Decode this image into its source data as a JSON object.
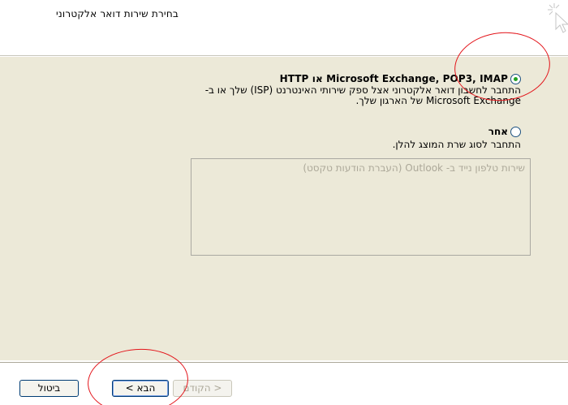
{
  "header": {
    "title": "בחירת שירות דואר אלקטרוני"
  },
  "options": {
    "option1": {
      "label": "Microsoft Exchange, POP3, IMAP או HTTP",
      "selected": true,
      "desc_line1": "התחבר לחשבון דואר אלקטרוני אצל ספק שירותי האינטרנט (ISP) שלך או ב-",
      "desc_line2": "Microsoft Exchange של הארגון שלך."
    },
    "option2": {
      "label": "אחר",
      "selected": false,
      "desc": "התחבר לסוג שרת המוצג להלן."
    }
  },
  "server_list": {
    "items": [
      "שירות טלפון נייד ב- Outlook (העברת הודעות טקסט)"
    ]
  },
  "buttons": {
    "cancel": "ביטול",
    "next": "הבא >",
    "back": "< הקודם"
  },
  "colors": {
    "dialog_bg": "#ece9d8",
    "annotation": "#e3141a"
  }
}
